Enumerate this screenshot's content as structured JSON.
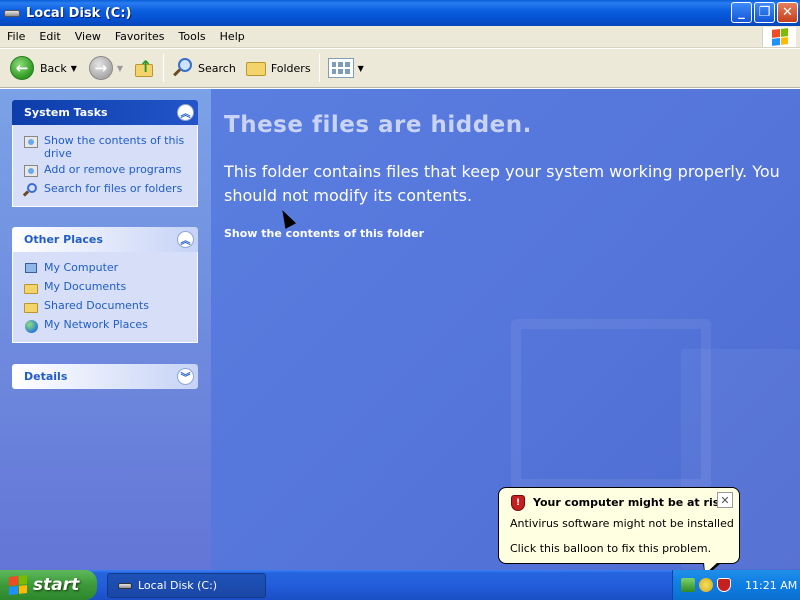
{
  "window": {
    "title": "Local Disk (C:)",
    "minimize_glyph": "_",
    "maximize_glyph": "❐",
    "close_glyph": "✕"
  },
  "menu": [
    "File",
    "Edit",
    "View",
    "Favorites",
    "Tools",
    "Help"
  ],
  "toolbar": {
    "back_label": "Back",
    "search_label": "Search",
    "folders_label": "Folders"
  },
  "left_pane": {
    "system_tasks": {
      "title": "System Tasks",
      "items": [
        {
          "label": "Show the contents of this drive",
          "icon": "show-contents-icon"
        },
        {
          "label": "Add or remove programs",
          "icon": "add-remove-programs-icon"
        },
        {
          "label": "Search for files or folders",
          "icon": "search-icon"
        }
      ]
    },
    "other_places": {
      "title": "Other Places",
      "items": [
        {
          "label": "My Computer",
          "icon": "my-computer-icon"
        },
        {
          "label": "My Documents",
          "icon": "my-documents-icon"
        },
        {
          "label": "Shared Documents",
          "icon": "shared-documents-icon"
        },
        {
          "label": "My Network Places",
          "icon": "my-network-places-icon"
        }
      ]
    },
    "details": {
      "title": "Details"
    }
  },
  "content": {
    "heading": "These files are hidden.",
    "message": "This folder contains files that keep your system working properly. You should not modify its contents.",
    "show_link": "Show the contents of this folder"
  },
  "balloon": {
    "title": "Your computer might be at risk",
    "line1": "Antivirus software might not be installed",
    "line2": "Click this balloon to fix this problem.",
    "close_glyph": "✕"
  },
  "taskbar": {
    "start_label": "start",
    "task_button_label": "Local Disk (C:)",
    "clock": "11:21 AM"
  }
}
